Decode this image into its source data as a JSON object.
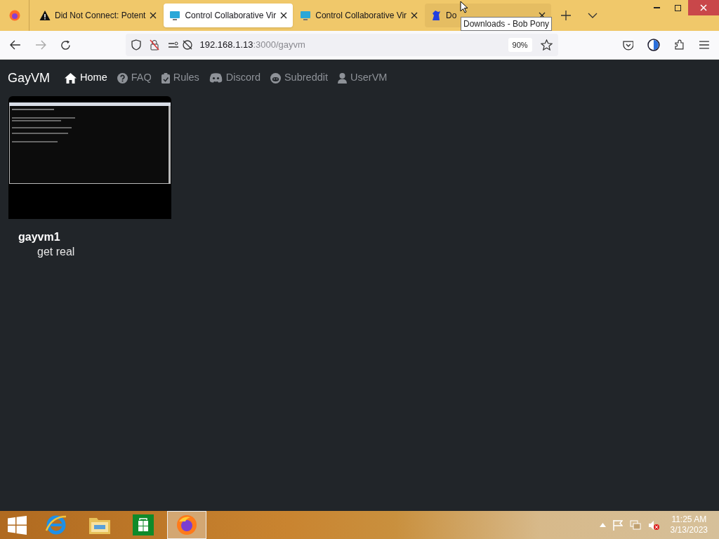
{
  "browser": {
    "tabs": [
      {
        "title": "Did Not Connect: Potent",
        "kind": "warning",
        "selected": false
      },
      {
        "title": "Control Collaborative Vir",
        "kind": "monitor",
        "selected": true
      },
      {
        "title": "Control Collaborative Vir",
        "kind": "monitor",
        "selected": false
      },
      {
        "title": "Do",
        "kind": "pony",
        "selected": false
      }
    ],
    "tooltip": "Downloads - Bob Pony",
    "address": {
      "host": "192.168.1.13",
      "path": ":3000/gayvm"
    },
    "zoom": "90%"
  },
  "site": {
    "brand": "GayVM",
    "nav": [
      {
        "label": "Home",
        "kind": "home",
        "selected": true
      },
      {
        "label": "FAQ",
        "kind": "question",
        "selected": false
      },
      {
        "label": "Rules",
        "kind": "clipboard",
        "selected": false
      },
      {
        "label": "Discord",
        "kind": "discord",
        "selected": false
      },
      {
        "label": "Subreddit",
        "kind": "reddit",
        "selected": false
      },
      {
        "label": "UserVM",
        "kind": "user",
        "selected": false
      }
    ],
    "vms": [
      {
        "name": "gayvm1",
        "description": "get real"
      }
    ]
  },
  "taskbar": {
    "apps": [
      {
        "kind": "ie",
        "selected": false
      },
      {
        "kind": "explorer",
        "selected": false
      },
      {
        "kind": "store",
        "selected": false
      },
      {
        "kind": "firefox",
        "selected": true
      }
    ],
    "time": "11:25 AM",
    "date": "3/13/2023"
  }
}
